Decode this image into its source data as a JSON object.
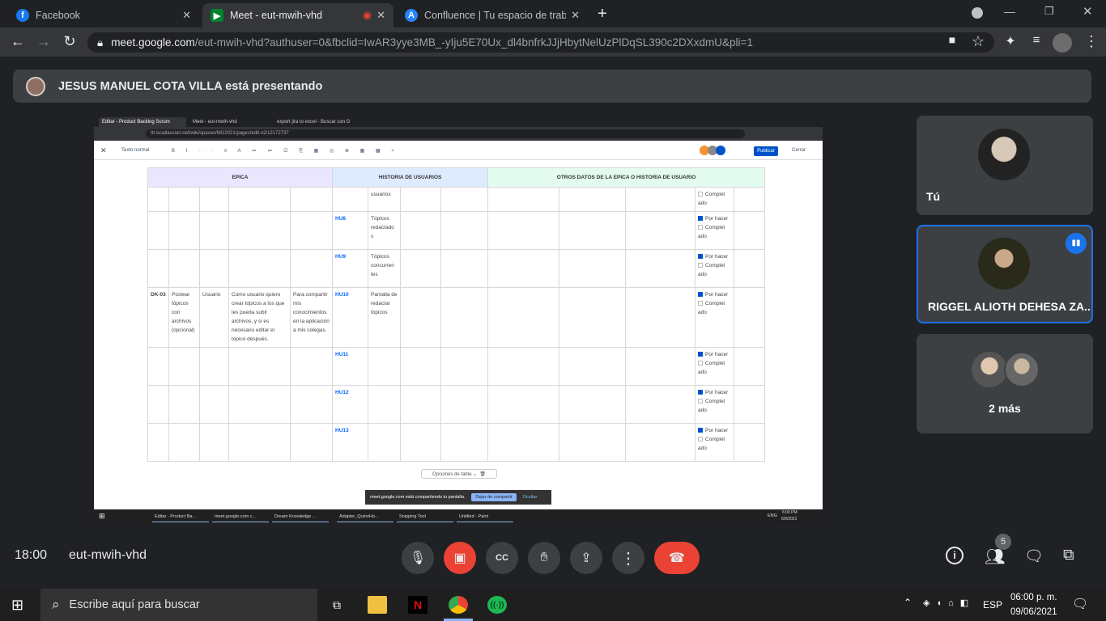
{
  "browser": {
    "tabs": [
      {
        "label": "Facebook",
        "icon": "facebook-icon",
        "active": false
      },
      {
        "label": "Meet - eut-mwih-vhd",
        "icon": "meet-icon",
        "active": true
      },
      {
        "label": "Confluence | Tu espacio de traba",
        "icon": "confluence-icon",
        "active": false
      }
    ],
    "url_host": "meet.google.com",
    "url_rest": "/eut-mwih-vhd?authuser=0&fbclid=IwAR3yye3MB_-yIju5E70Ux_dl4bnfrkJJjHbytNelUzPlDqSL390c2DXxdmU&pli=1"
  },
  "meet": {
    "presenter_banner": "JESUS MANUEL COTA VILLA está presentando",
    "meeting_time": "18:00",
    "meeting_code": "eut-mwih-vhd",
    "participant_count": "5",
    "participants": [
      {
        "name": "Tú"
      },
      {
        "name": "RIGGEL ALIOTH DEHESA ZA..."
      },
      {
        "name": "2 más"
      }
    ]
  },
  "shared": {
    "tabs": [
      "Editar - Product Backlog Scrum",
      "Meet - eut-mwih-vhd",
      "export jira to excel - Buscar con G"
    ],
    "url": "ttt.iscatlassian.net/wiki/spaces/MG2021/pages/edit-v2/12172737",
    "editor": {
      "style_label": "Texto normal",
      "publish": "Publicar",
      "close": "Cerrar"
    },
    "headers": {
      "epica": "EPICA",
      "historia": "HISTORIA DE USUARIOS",
      "otros": "OTROS DATOS DE LA EPICA O HISTORIA DE USUARIO"
    },
    "rows": [
      {
        "code": "",
        "title": "",
        "role": "",
        "story": "",
        "reason": "",
        "hu": "",
        "hu_title": "usuarios",
        "checks": [
          {
            "on": false,
            "label": "Complet ado"
          }
        ]
      },
      {
        "code": "",
        "title": "",
        "role": "",
        "story": "",
        "reason": "",
        "hu": "HU8",
        "hu_title": "Tópicos redactado s",
        "checks": [
          {
            "on": true,
            "label": "Por hacer"
          },
          {
            "on": false,
            "label": "Complet ado"
          }
        ]
      },
      {
        "code": "",
        "title": "",
        "role": "",
        "story": "",
        "reason": "",
        "hu": "HU9",
        "hu_title": "Tópicos concurren tes",
        "checks": [
          {
            "on": true,
            "label": "Por hacer"
          },
          {
            "on": false,
            "label": "Complet ado"
          }
        ]
      },
      {
        "code": "DK-03",
        "title": "Postear tópicos con archivos (opcional)",
        "role": "Usuario",
        "story": "Como usuario quiero crear tópicos a los que les pueda subir archivos, y si es necesario editar el tópico después.",
        "reason": "Para compartir mis conocimientos en la aplicación a mis colegas.",
        "hu": "HU10",
        "hu_title": "Pantalla de redactar tópicos",
        "checks": [
          {
            "on": true,
            "label": "Por hacer"
          },
          {
            "on": false,
            "label": "Complet ado"
          }
        ]
      },
      {
        "code": "",
        "title": "",
        "role": "",
        "story": "",
        "reason": "",
        "hu": "HU11",
        "hu_title": "",
        "checks": [
          {
            "on": true,
            "label": "Por hacer"
          },
          {
            "on": false,
            "label": "Complet ado"
          }
        ]
      },
      {
        "code": "",
        "title": "",
        "role": "",
        "story": "",
        "reason": "",
        "hu": "HU12",
        "hu_title": "",
        "checks": [
          {
            "on": true,
            "label": "Por hacer"
          },
          {
            "on": false,
            "label": "Complet ado"
          }
        ]
      },
      {
        "code": "",
        "title": "",
        "role": "",
        "story": "",
        "reason": "",
        "hu": "HU13",
        "hu_title": "",
        "checks": [
          {
            "on": true,
            "label": "Por hacer"
          },
          {
            "on": false,
            "label": "Complet ado"
          }
        ]
      }
    ],
    "table_options": "Opciones de tabla",
    "share_notice": "meet.google.com está compartiendo tu pantalla.",
    "stop_share": "Dejar de compartir",
    "hide": "Ocultar",
    "taskbar": [
      "Editar - Product Ba...",
      "meet.google.com c...",
      "Dream Knowledge ...",
      "Adapter_QuinoHo...",
      "Snipping Tool",
      "Untitled - Paint"
    ],
    "taskbar_lang": "ENG",
    "taskbar_time": "6:00 PM",
    "taskbar_date": "6/9/2021"
  },
  "windows": {
    "search_placeholder": "Escribe aquí para buscar",
    "lang": "ESP",
    "time": "06:00 p. m.",
    "date": "09/06/2021"
  },
  "colors": {
    "meet_red": "#ea4335",
    "active_tile_border": "#1a73e8",
    "publish_blue": "#0052cc"
  }
}
